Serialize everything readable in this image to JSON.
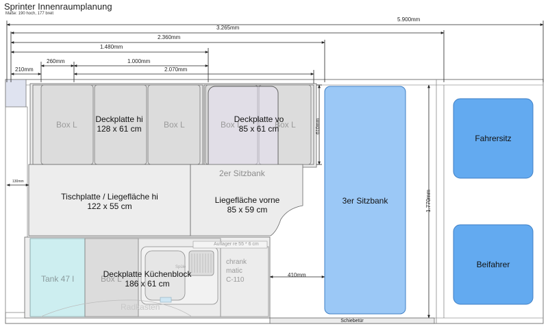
{
  "title": "Sprinter Innenraumplanung",
  "subtitle": "Maße: 190 hoch, 177 breit",
  "dimensions": {
    "d5900": "5.900mm",
    "d3265": "3.265mm",
    "d2360": "2.360mm",
    "d1480": "1.480mm",
    "d210": "210mm",
    "d260": "260mm",
    "d1000": "1.000mm",
    "d2070": "2.070mm",
    "d610": "610mm",
    "d130": "130mm",
    "d1770": "1.770mm",
    "d410": "410mm"
  },
  "labels": {
    "deckplatte_hi": "Deckplatte hi",
    "deckplatte_hi_size": "128 x 61 cm",
    "deckplatte_vo": "Deckplatte vo",
    "deckplatte_vo_size": "85 x 61 cm",
    "box_l": "Box L",
    "sitzbank_2er": "2er Sitzbank",
    "tischplatte": "Tischplatte / Liegefläche hi",
    "tischplatte_size": "122 x 55 cm",
    "liegeflaeche_vorne": "Liegefläche vorne",
    "liegeflaeche_vorne_size": "85 x 59 cm",
    "auflager": "Auflager re 55 * 6 cm",
    "tank": "Tank 47 l",
    "kuechen": "Deckplatte Küchenblock",
    "kuechen_size": "186 x 61 cm",
    "spule": "Spüle",
    "kuehlschrank_1": "chrank",
    "kuehlschrank_2": "matic",
    "kuehlschrank_3": "C-110",
    "radkasten": "Radkasten",
    "sitzbank_3er": "3er Sitzbank",
    "fahrersitz": "Fahrersitz",
    "beifahrer": "Beifahrer",
    "schiebetuer": "Schiebetür"
  },
  "colors": {
    "seat_blue": "#63aaf0",
    "seat_blue_dark": "#3f7fc4",
    "bench_blue": "#9bc8f6",
    "tank_teal": "#cdeef0",
    "panel_grey": "#ececec",
    "box_grey": "#dedede",
    "outline": "#555555"
  }
}
